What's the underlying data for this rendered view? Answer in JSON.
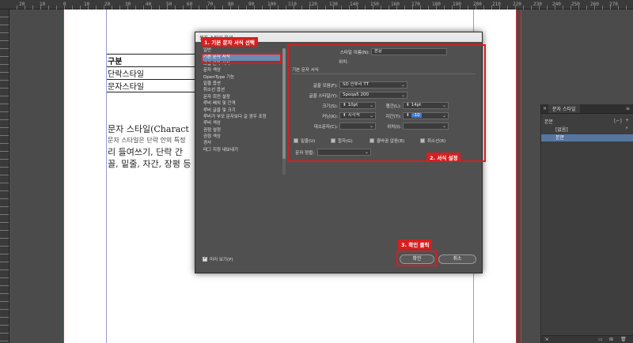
{
  "ruler": {
    "ticks": [
      "20",
      "10",
      "0",
      "10",
      "20",
      "30",
      "40",
      "50",
      "60",
      "70",
      "80",
      "90",
      "100",
      "110",
      "120",
      "130",
      "140",
      "150",
      "160",
      "170",
      "180",
      "190",
      "200",
      "210",
      "220",
      "230",
      "240",
      "250",
      "260",
      "270",
      "280",
      "290"
    ]
  },
  "document": {
    "table_rows": [
      "구분",
      "단락스타일",
      "문자스타일"
    ],
    "text_lines": [
      "문자 스타일(Charact",
      "문자 스타일은 단락 안의 특정",
      "리 들여쓰기, 단락 간",
      "꼴, 밑줄, 자간, 장평 등"
    ]
  },
  "dialog": {
    "title": "문자 스타일 옵션",
    "categories": [
      "일반",
      "기본 문자 서식",
      "고급 문자 서식",
      "문자 색상",
      "OpenType 기능",
      "밑줄 옵션",
      "취소선 옵션",
      "문자 회전 설정",
      "루비 배치 및 간격",
      "루비 글꼴 및 크기",
      "루비가 부모 문자보다 길 경우 조정",
      "루비 색상",
      "권점 설정",
      "권점 색상",
      "경사",
      "태그 지정 내보내기"
    ],
    "selected_index": 1,
    "style_name_label": "스타일 이름(N):",
    "style_name_value": "본문",
    "position_label": "위치:",
    "section_title": "기본 문자 서식",
    "font_family_label": "글꼴 모음(F):",
    "font_family_value": "SD 민부리 TT",
    "font_style_label": "글꼴 스타일(Y):",
    "font_style_value": "Spoqa5 200",
    "size_label": "크기(S):",
    "size_value": "10pt",
    "leading_label": "행간(L):",
    "leading_value": "14pt",
    "kerning_label": "커닝(K):",
    "kerning_value": "시각적",
    "tracking_label": "자간(T):",
    "tracking_value": "-10",
    "case_label": "대소문자(C):",
    "position2_label": "위치(I):",
    "checkboxes": [
      "밑줄(U)",
      "합자(G)",
      "줄바꿈 없음(B)",
      "취소선(R)"
    ],
    "char_align_label": "문자 정렬:",
    "preview_label": "미리 보기(P)",
    "ok_label": "확인",
    "cancel_label": "취소"
  },
  "annotations": {
    "step1": "1. 기본 문자 서식 선택",
    "step2": "2. 서식 설정",
    "step3": "3. 확인 클릭",
    "color": "#e01a1a"
  },
  "panel": {
    "tab_label": "문자 스타일",
    "current_style": "본문",
    "items": [
      "[없음]",
      "본문"
    ],
    "selected_index": 1,
    "selected_color": "#5676a0"
  }
}
